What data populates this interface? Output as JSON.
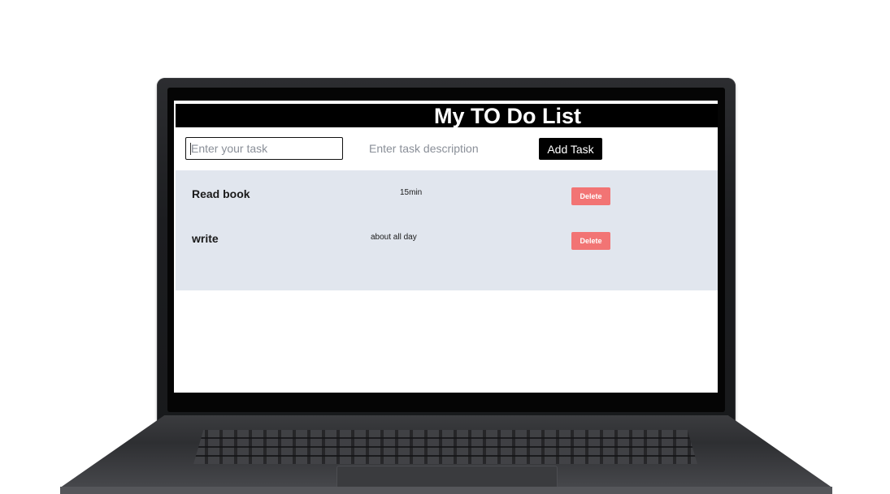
{
  "app": {
    "title": "My TO Do List"
  },
  "form": {
    "task_placeholder": "Enter your task",
    "description_placeholder": "Enter task description",
    "add_label": "Add Task"
  },
  "tasks": [
    {
      "name": "Read book",
      "description": "15min",
      "delete_label": "Delete"
    },
    {
      "name": "write",
      "description": "about all day",
      "delete_label": "Delete"
    }
  ],
  "colors": {
    "header_bg": "#000000",
    "list_bg": "#e1e6ee",
    "delete_bg": "#f27474",
    "add_bg": "#000000"
  }
}
